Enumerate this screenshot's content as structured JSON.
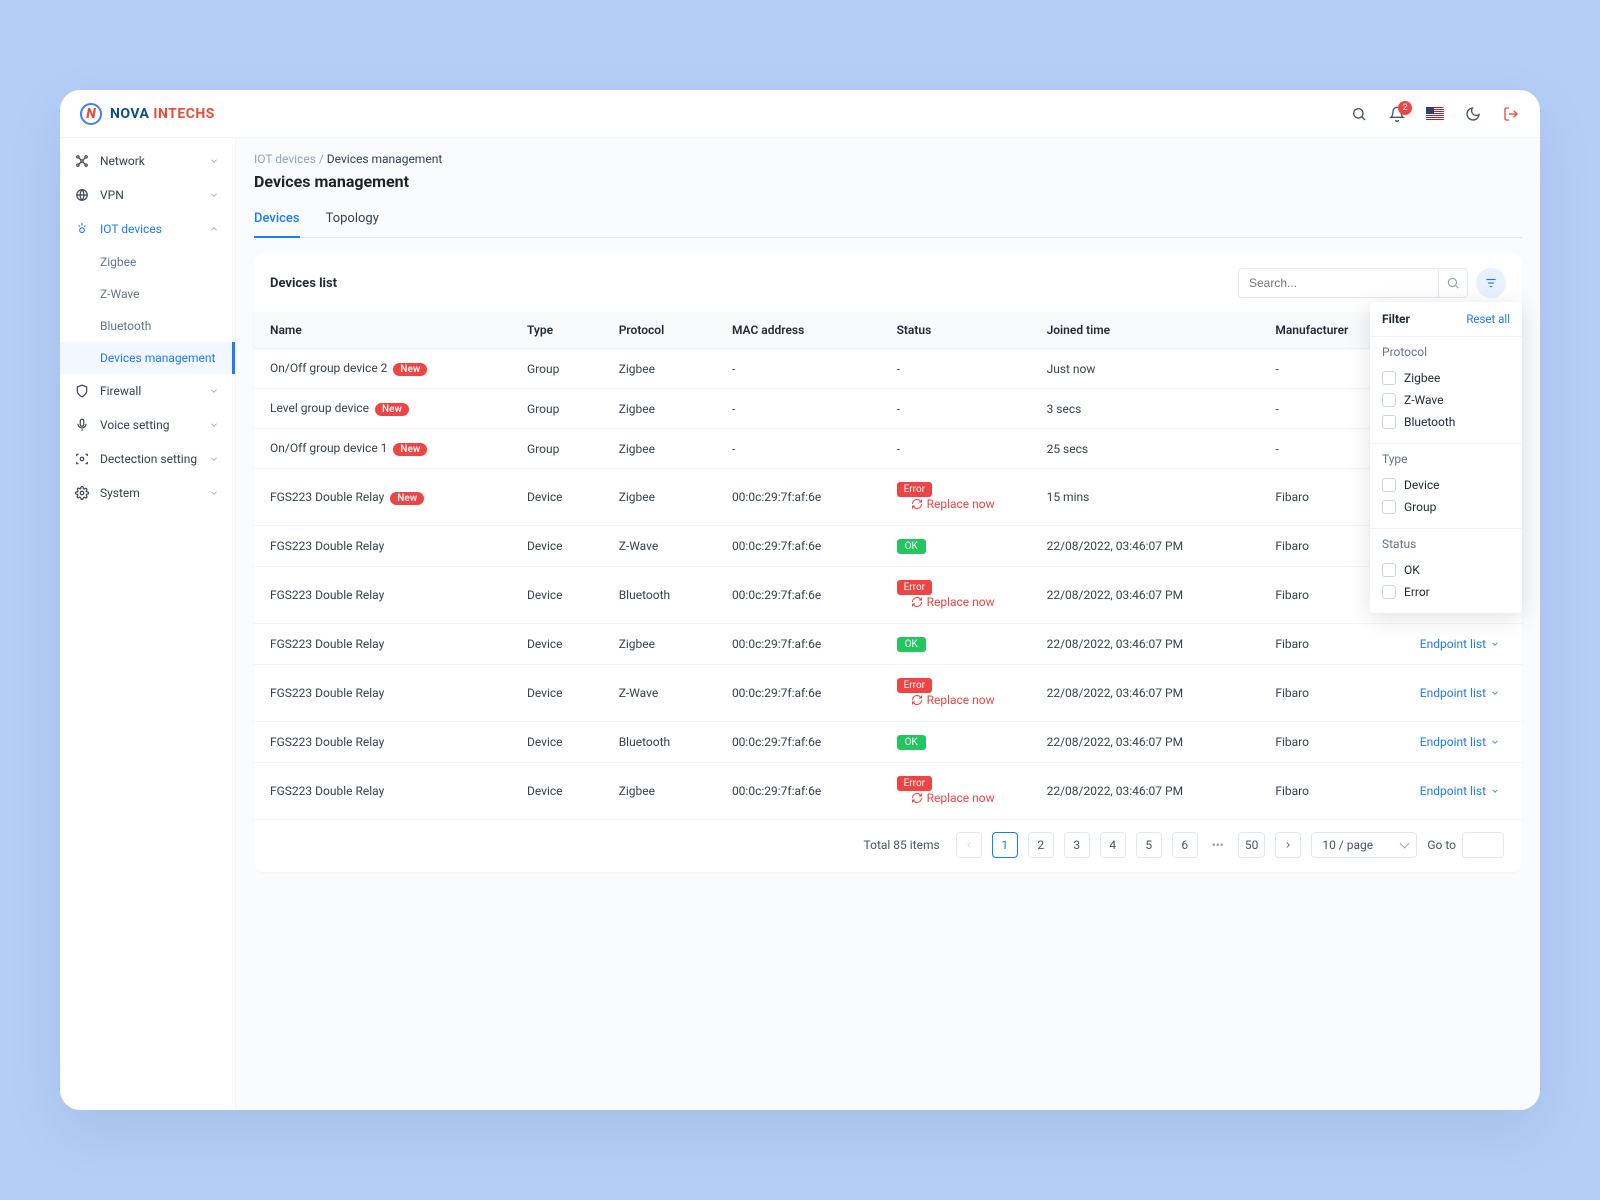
{
  "brand": {
    "name_a": "NOVA ",
    "name_b": "INTECHS"
  },
  "header": {
    "notif_count": "2"
  },
  "sidebar": {
    "items": [
      {
        "label": "Network"
      },
      {
        "label": "VPN"
      },
      {
        "label": "IOT devices"
      },
      {
        "label": "Firewall"
      },
      {
        "label": "Voice setting"
      },
      {
        "label": "Dectection setting"
      },
      {
        "label": "System"
      }
    ],
    "iot_sub": [
      {
        "label": "Zigbee"
      },
      {
        "label": "Z-Wave"
      },
      {
        "label": "Bluetooth"
      },
      {
        "label": "Devices management"
      }
    ]
  },
  "breadcrumb": {
    "root": "IOT devices",
    "sep": " / ",
    "current": "Devices management"
  },
  "page_title": "Devices management",
  "tabs": [
    {
      "label": "Devices"
    },
    {
      "label": "Topology"
    }
  ],
  "devices_list": {
    "title": "Devices list",
    "search_placeholder": "Search...",
    "columns": [
      "Name",
      "Type",
      "Protocol",
      "MAC address",
      "Status",
      "Joined time",
      "Manufacturer"
    ],
    "endpoint_label": "Endpoint list",
    "replace_label": "Replace now",
    "new_badge": "New",
    "status_ok": "OK",
    "status_error": "Error",
    "rows": [
      {
        "name": "On/Off group device 2",
        "new": true,
        "type": "Group",
        "protocol": "Zigbee",
        "mac": "-",
        "status": "none",
        "joined": "Just now",
        "manuf": "-"
      },
      {
        "name": "Level group device",
        "new": true,
        "type": "Group",
        "protocol": "Zigbee",
        "mac": "-",
        "status": "none",
        "joined": "3 secs",
        "manuf": "-"
      },
      {
        "name": "On/Off group device 1",
        "new": true,
        "type": "Group",
        "protocol": "Zigbee",
        "mac": "-",
        "status": "none",
        "joined": "25 secs",
        "manuf": "-"
      },
      {
        "name": "FGS223 Double Relay",
        "new": true,
        "type": "Device",
        "protocol": "Zigbee",
        "mac": "00:0c:29:7f:af:6e",
        "status": "error",
        "joined": "15 mins",
        "manuf": "Fibaro"
      },
      {
        "name": "FGS223 Double Relay",
        "new": false,
        "type": "Device",
        "protocol": "Z-Wave",
        "mac": "00:0c:29:7f:af:6e",
        "status": "ok",
        "joined": "22/08/2022, 03:46:07 PM",
        "manuf": "Fibaro"
      },
      {
        "name": "FGS223 Double Relay",
        "new": false,
        "type": "Device",
        "protocol": "Bluetooth",
        "mac": "00:0c:29:7f:af:6e",
        "status": "error",
        "joined": "22/08/2022, 03:46:07 PM",
        "manuf": "Fibaro"
      },
      {
        "name": "FGS223 Double Relay",
        "new": false,
        "type": "Device",
        "protocol": "Zigbee",
        "mac": "00:0c:29:7f:af:6e",
        "status": "ok",
        "joined": "22/08/2022, 03:46:07 PM",
        "manuf": "Fibaro"
      },
      {
        "name": "FGS223 Double Relay",
        "new": false,
        "type": "Device",
        "protocol": "Z-Wave",
        "mac": "00:0c:29:7f:af:6e",
        "status": "error",
        "joined": "22/08/2022, 03:46:07 PM",
        "manuf": "Fibaro"
      },
      {
        "name": "FGS223 Double Relay",
        "new": false,
        "type": "Device",
        "protocol": "Bluetooth",
        "mac": "00:0c:29:7f:af:6e",
        "status": "ok",
        "joined": "22/08/2022, 03:46:07 PM",
        "manuf": "Fibaro"
      },
      {
        "name": "FGS223 Double Relay",
        "new": false,
        "type": "Device",
        "protocol": "Zigbee",
        "mac": "00:0c:29:7f:af:6e",
        "status": "error",
        "joined": "22/08/2022, 03:46:07 PM",
        "manuf": "Fibaro"
      }
    ]
  },
  "pagination": {
    "total_label": "Total 85 items",
    "pages": [
      "1",
      "2",
      "3",
      "4",
      "5",
      "6",
      "50"
    ],
    "page_size": "10 / page",
    "goto_label": "Go to"
  },
  "filter": {
    "title": "Filter",
    "reset": "Reset all",
    "sections": [
      {
        "title": "Protocol",
        "options": [
          "Zigbee",
          "Z-Wave",
          "Bluetooth"
        ]
      },
      {
        "title": "Type",
        "options": [
          "Device",
          "Group"
        ]
      },
      {
        "title": "Status",
        "options": [
          "OK",
          "Error"
        ]
      }
    ]
  }
}
